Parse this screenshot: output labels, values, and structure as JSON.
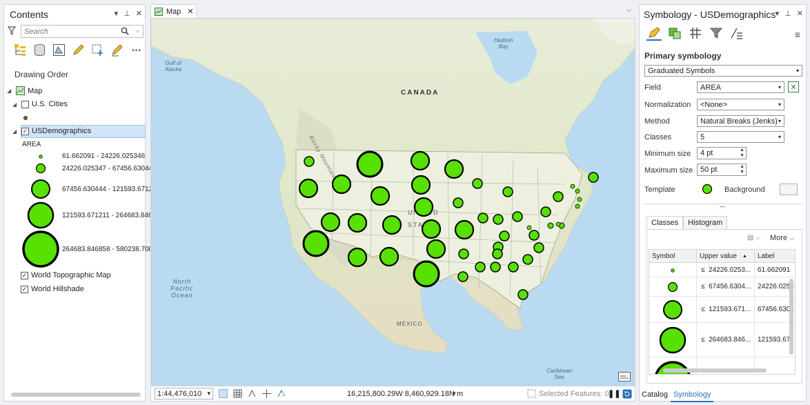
{
  "contents": {
    "title": "Contents",
    "search_placeholder": "Search",
    "drawing_order": "Drawing Order",
    "map_label": "Map",
    "layers": {
      "us_cities": "U.S. Cities",
      "usdemographics": "USDemographics",
      "world_topo": "World Topographic Map",
      "world_hillshade": "World Hillshade"
    },
    "legend_field": "AREA",
    "legend_classes": [
      "61.662091 - 24226.025346",
      "24226.025347 - 67456.63044",
      "67456.630444 - 121593.6712",
      "121593.671211 - 264683.846",
      "264683.846858 - 580238.700"
    ]
  },
  "map": {
    "tab_label": "Map",
    "labels": {
      "canada": "CANADA",
      "united_states_1": "UNITED",
      "united_states_2": "STATES",
      "mexico": "MÉXICO",
      "north_pacific_1": "North",
      "north_pacific_2": "Pacific",
      "north_pacific_3": "Ocean",
      "gulf_alaska_1": "Gulf of",
      "gulf_alaska_2": "Alaska",
      "hudson_1": "Hudson",
      "hudson_2": "Bay",
      "caribbean_1": "Caribbean",
      "caribbean_2": "Sea",
      "rocky": "Rocky Mountains"
    },
    "symbol_color": "#57e000",
    "status": {
      "scale": "1:44,476,010",
      "coords": "16,215,800.29W 8,460,929.18N m",
      "selected": "Selected Features: 0"
    }
  },
  "symbology": {
    "title": "Symbology - USDemographics",
    "primary": "Primary symbology",
    "type": "Graduated Symbols",
    "field_label": "Field",
    "field_value": "AREA",
    "normalization_label": "Normalization",
    "normalization_value": "<None>",
    "method_label": "Method",
    "method_value": "Natural Breaks (Jenks)",
    "classes_label": "Classes",
    "classes_value": "5",
    "min_size_label": "Minimum size",
    "min_size_value": "4 pt",
    "max_size_label": "Maximum size",
    "max_size_value": "50 pt",
    "template_label": "Template",
    "background_label": "Background",
    "tab_classes": "Classes",
    "tab_histogram": "Histogram",
    "more": "More",
    "col_symbol": "Symbol",
    "col_upper": "Upper value",
    "col_label": "Label",
    "rows": [
      {
        "op": "≤",
        "upper": "24226.0253...",
        "label": "61.662091"
      },
      {
        "op": "≤",
        "upper": "67456.6304...",
        "label": "24226.0253"
      },
      {
        "op": "≤",
        "upper": "121593.671...",
        "label": "67456.6304"
      },
      {
        "op": "≤",
        "upper": "264683.846...",
        "label": "121593.67"
      }
    ],
    "bottom_tab_catalog": "Catalog",
    "bottom_tab_symbology": "Symbology"
  }
}
